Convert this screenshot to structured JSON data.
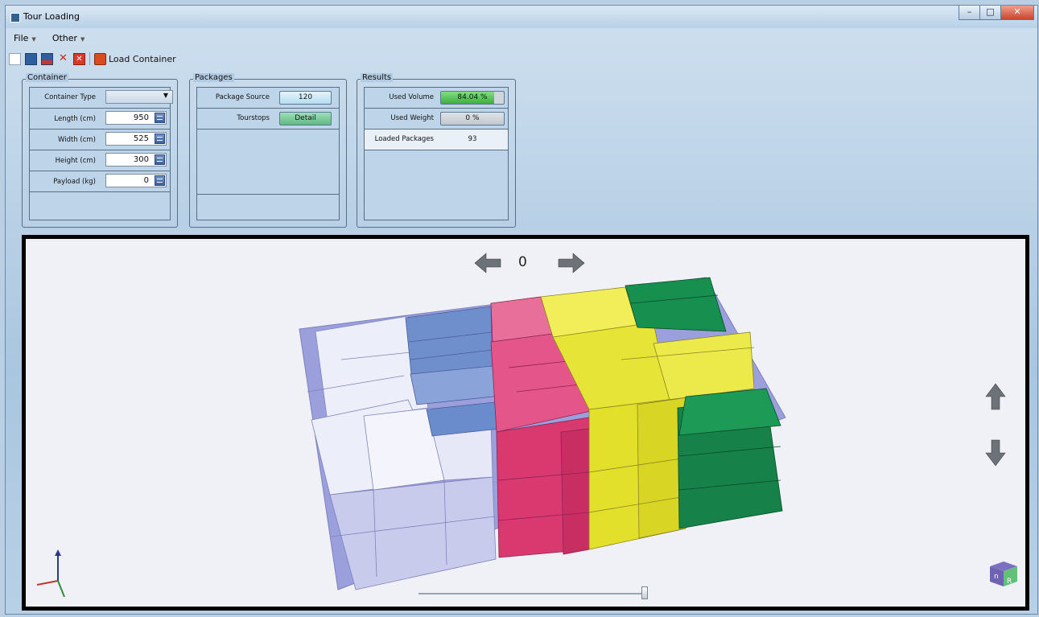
{
  "window": {
    "title": "Tour Loading",
    "controls": [
      "–",
      "□",
      "✕"
    ]
  },
  "menu": {
    "items": [
      "File",
      "Other"
    ]
  },
  "toolbar": {
    "load_label": "Load Container"
  },
  "container_group": {
    "title": "Container",
    "type_label": "Container Type",
    "type_value": "",
    "fields": [
      {
        "label": "Length (cm)",
        "value": "950"
      },
      {
        "label": "Width (cm)",
        "value": "525"
      },
      {
        "label": "Height (cm)",
        "value": "300"
      },
      {
        "label": "Payload (kg)",
        "value": "0"
      }
    ]
  },
  "packages_group": {
    "title": "Packages",
    "source_label": "Package Source",
    "source_value": "120",
    "tourstops_label": "Tourstops",
    "tourstops_button": "Detail"
  },
  "results_group": {
    "title": "Results",
    "used_volume_label": "Used Volume",
    "used_volume_value": "84.04 %",
    "used_volume_fraction": 0.8404,
    "used_weight_label": "Used Weight",
    "used_weight_value": "0 %",
    "loaded_packages_label": "Loaded Packages",
    "loaded_packages_value": "93"
  },
  "viewer": {
    "stop_index": "0",
    "slider_fraction": 0.99,
    "orientation_cube_labels": [
      "n",
      "R"
    ],
    "colors": {
      "white_boxes": "#eceef9",
      "lavender_boxes": "#c9cbec",
      "blue_boxes": "#6e8fcc",
      "pink_boxes": "#e4568a",
      "yellow_boxes": "#e6e436",
      "green_boxes": "#16824a",
      "container_floor": "#9b9fdc"
    }
  }
}
